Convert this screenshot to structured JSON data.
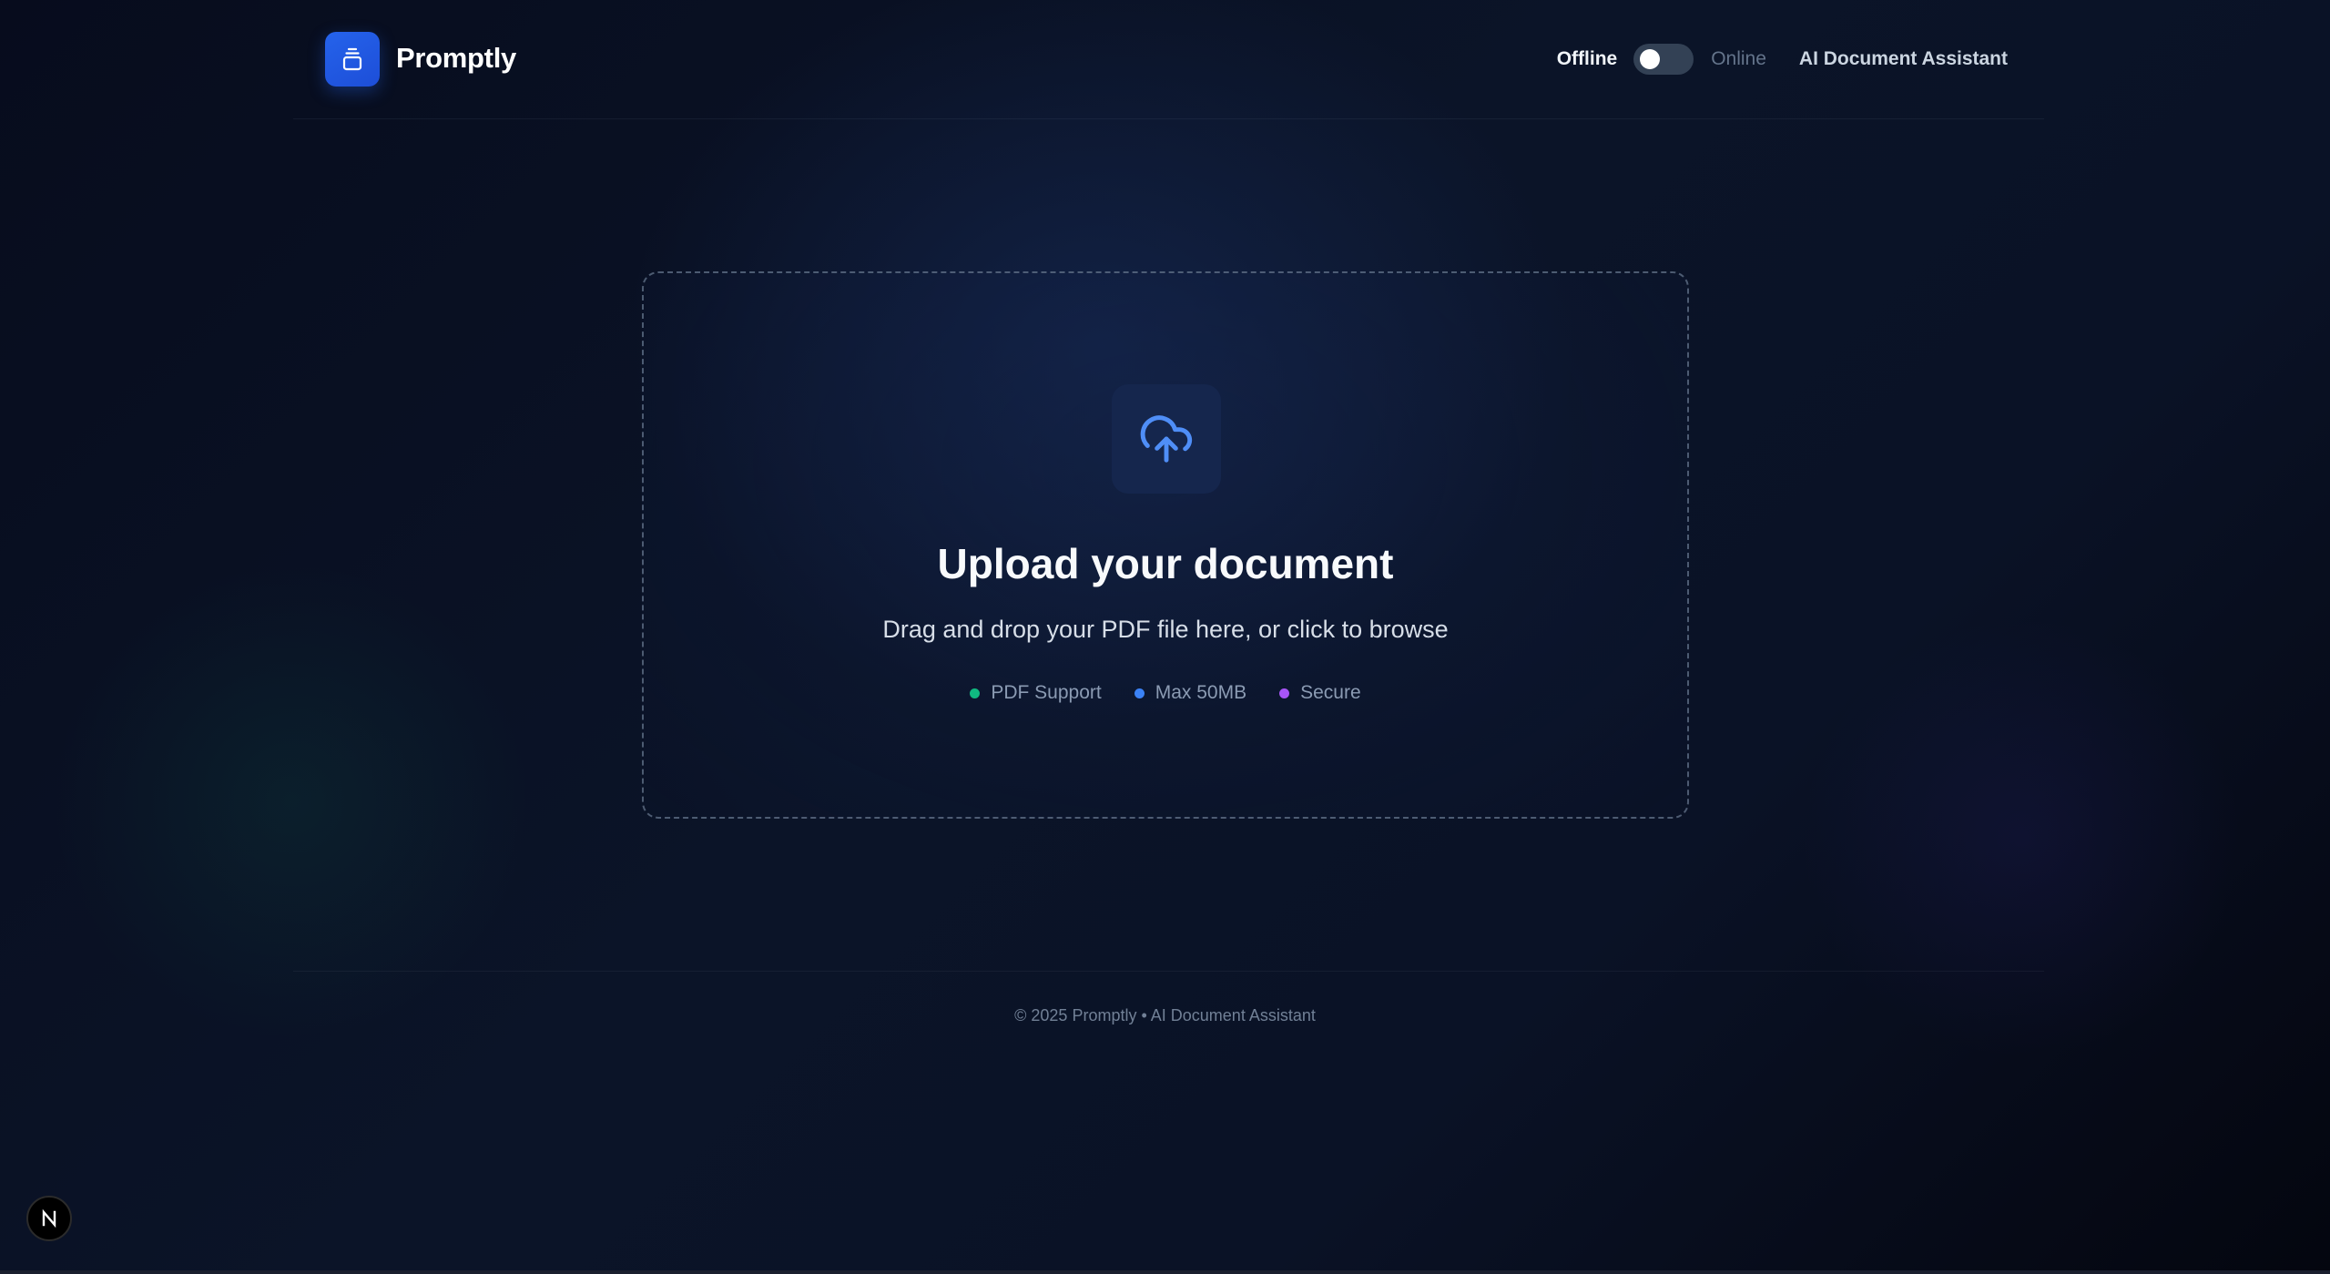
{
  "header": {
    "brand": "Promptly",
    "mode_offline_label": "Offline",
    "mode_online_label": "Online",
    "tagline": "AI Document Assistant",
    "toggle_state": "offline"
  },
  "upload": {
    "title": "Upload your document",
    "subtitle": "Drag and drop your PDF file here, or click to browse",
    "features": [
      {
        "label": "PDF Support",
        "dot_color": "#10b981"
      },
      {
        "label": "Max 50MB",
        "dot_color": "#3b82f6"
      },
      {
        "label": "Secure",
        "dot_color": "#a855f7"
      }
    ]
  },
  "footer": {
    "text": "© 2025 Promptly • AI Document Assistant"
  },
  "icons": {
    "logo": "stacked-document-icon",
    "upload": "cloud-upload-icon",
    "floating": "n-logo-icon"
  },
  "colors": {
    "accent": "#2563eb",
    "upload_icon": "#4f8ef7",
    "background": "#0b1428"
  }
}
